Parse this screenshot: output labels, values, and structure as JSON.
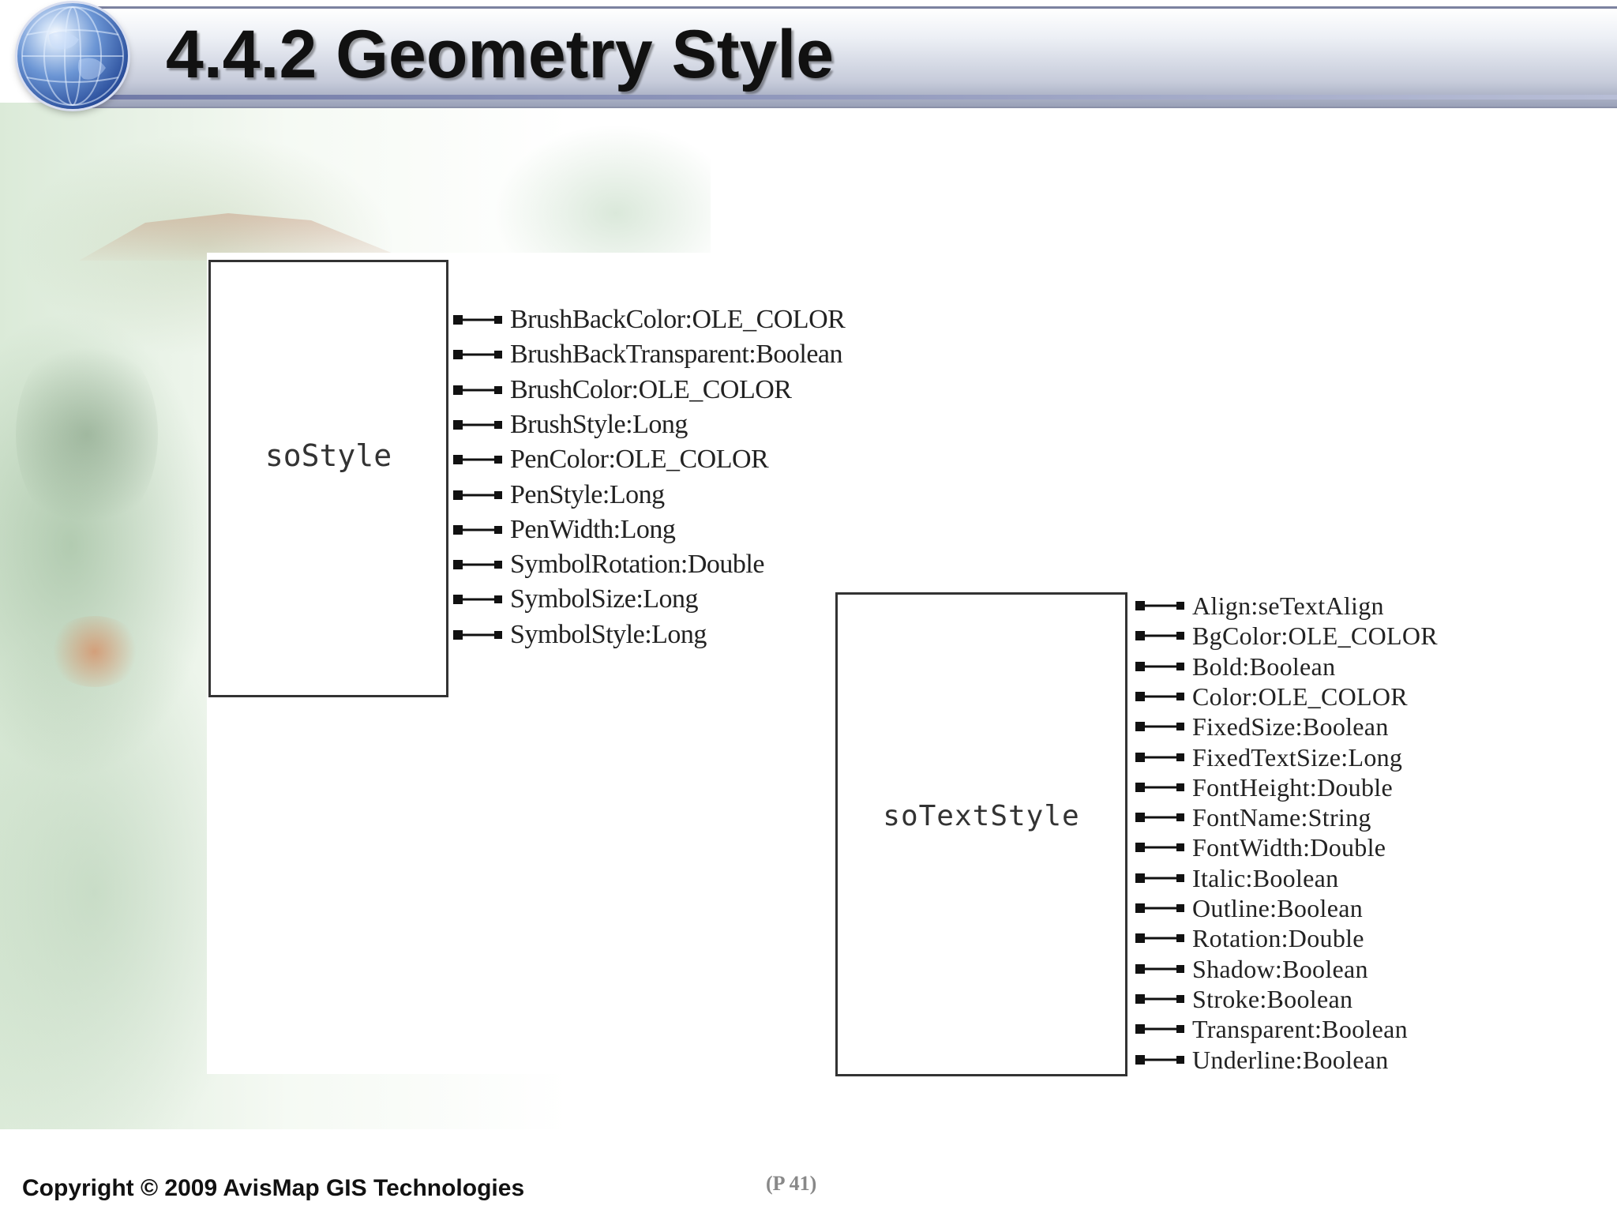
{
  "slide": {
    "title": "4.4.2 Geometry Style",
    "footer_copyright": "Copyright © 2009 AvisMap GIS Technologies",
    "page_number": "(P 41)",
    "logo_icon": "globe-icon"
  },
  "diagram": {
    "classes": [
      {
        "name": "soStyle",
        "attributes": [
          "BrushBackColor:OLE_COLOR",
          "BrushBackTransparent:Boolean",
          "BrushColor:OLE_COLOR",
          "BrushStyle:Long",
          "PenColor:OLE_COLOR",
          "PenStyle:Long",
          "PenWidth:Long",
          "SymbolRotation:Double",
          "SymbolSize:Long",
          "SymbolStyle:Long"
        ]
      },
      {
        "name": "soTextStyle",
        "attributes": [
          "Align:seTextAlign",
          "BgColor:OLE_COLOR",
          "Bold:Boolean",
          "Color:OLE_COLOR",
          "FixedSize:Boolean",
          "FixedTextSize:Long",
          "FontHeight:Double",
          "FontName:String",
          "FontWidth:Double",
          "Italic:Boolean",
          "Outline:Boolean",
          "Rotation:Double",
          "Shadow:Boolean",
          "Stroke:Boolean",
          "Transparent:Boolean",
          "Underline:Boolean"
        ]
      }
    ]
  }
}
